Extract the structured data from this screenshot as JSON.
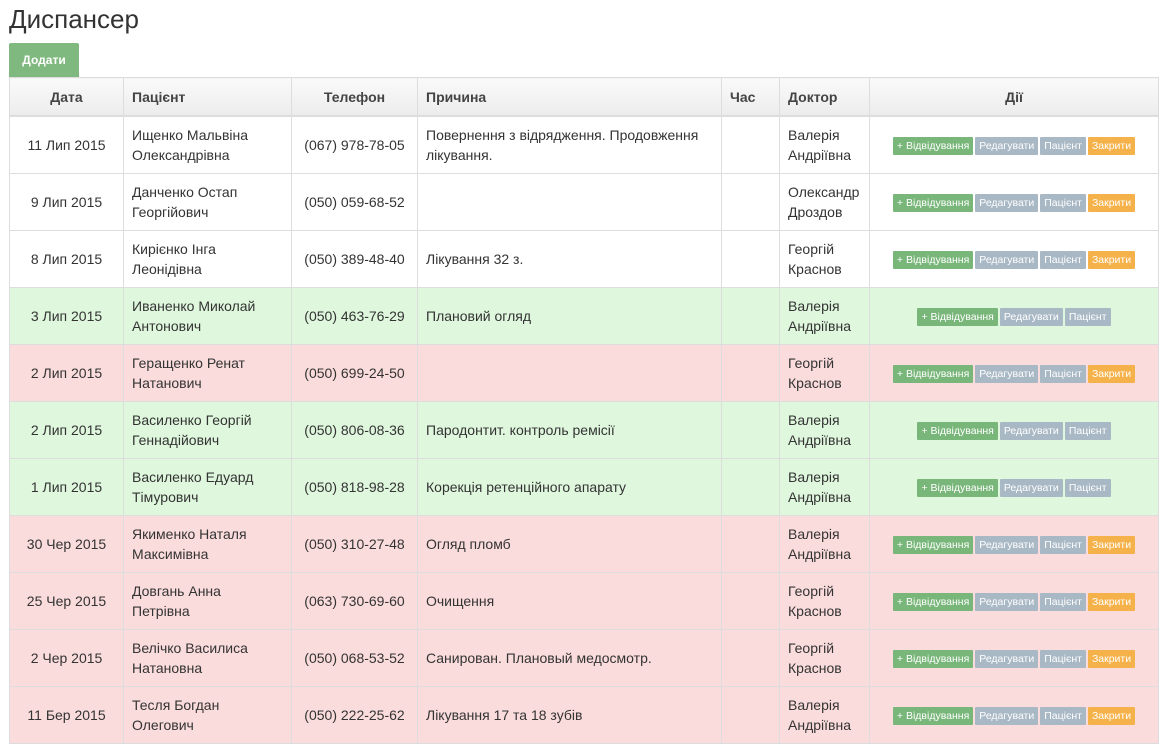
{
  "page": {
    "title": "Диспансер"
  },
  "toolbar": {
    "add_label": "Додати"
  },
  "table": {
    "columns": {
      "date": "Дата",
      "patient": "Пацієнт",
      "phone": "Телефон",
      "reason": "Причина",
      "time": "Час",
      "doctor": "Доктор",
      "actions": "Дії"
    },
    "action_labels": {
      "visit": "+ Відвідування",
      "edit": "Редагувати",
      "patient": "Пацієнт",
      "close": "Закрити"
    },
    "rows": [
      {
        "date": "11 Лип 2015",
        "patient_line1": "Ищенко Мальвіна",
        "patient_line2": "Олександрівна",
        "phone": "(067) 978-78-05",
        "reason": "Повернення з відрядження. Продовження лікування.",
        "time": "",
        "doctor_line1": "Валерія",
        "doctor_line2": "Андріївна",
        "status": "default",
        "closable": true
      },
      {
        "date": "9 Лип 2015",
        "patient_line1": "Данченко Остап",
        "patient_line2": "Георгійович",
        "phone": "(050) 059-68-52",
        "reason": "",
        "time": "",
        "doctor_line1": "Олександр",
        "doctor_line2": "Дроздов",
        "status": "default",
        "closable": true
      },
      {
        "date": "8 Лип 2015",
        "patient_line1": "Кирієнко Інга",
        "patient_line2": "Леонідівна",
        "phone": "(050) 389-48-40",
        "reason": "Лікування 32 з.",
        "time": "",
        "doctor_line1": "Георгій",
        "doctor_line2": "Краснов",
        "status": "default",
        "closable": true
      },
      {
        "date": "3 Лип 2015",
        "patient_line1": "Иваненко Миколай",
        "patient_line2": "Антонович",
        "phone": "(050) 463-76-29",
        "reason": "Плановий огляд",
        "time": "",
        "doctor_line1": "Валерія",
        "doctor_line2": "Андріївна",
        "status": "success",
        "closable": false
      },
      {
        "date": "2 Лип 2015",
        "patient_line1": "Геращенко Ренат",
        "patient_line2": "Натанович",
        "phone": "(050) 699-24-50",
        "reason": "",
        "time": "",
        "doctor_line1": "Георгій",
        "doctor_line2": "Краснов",
        "status": "danger",
        "closable": true
      },
      {
        "date": "2 Лип 2015",
        "patient_line1": "Василенко Георгій",
        "patient_line2": "Геннадійович",
        "phone": "(050) 806-08-36",
        "reason": "Пародонтит. контроль ремісії",
        "time": "",
        "doctor_line1": "Валерія",
        "doctor_line2": "Андріївна",
        "status": "success",
        "closable": false
      },
      {
        "date": "1 Лип 2015",
        "patient_line1": "Василенко Едуард",
        "patient_line2": "Тімурович",
        "phone": "(050) 818-98-28",
        "reason": "Корекція ретенційного апарату",
        "time": "",
        "doctor_line1": "Валерія",
        "doctor_line2": "Андріївна",
        "status": "success",
        "closable": false
      },
      {
        "date": "30 Чер 2015",
        "patient_line1": "Якименко Наталя",
        "patient_line2": "Максимівна",
        "phone": "(050) 310-27-48",
        "reason": "Огляд пломб",
        "time": "",
        "doctor_line1": "Валерія",
        "doctor_line2": "Андріївна",
        "status": "danger",
        "closable": true
      },
      {
        "date": "25 Чер 2015",
        "patient_line1": "Довгань Анна",
        "patient_line2": "Петрівна",
        "phone": "(063) 730-69-60",
        "reason": "Очищення",
        "time": "",
        "doctor_line1": "Георгій",
        "doctor_line2": "Краснов",
        "status": "danger",
        "closable": true
      },
      {
        "date": "2 Чер 2015",
        "patient_line1": "Велічко Василиса",
        "patient_line2": "Натановна",
        "phone": "(050) 068-53-52",
        "reason": "Санирован. Плановый медосмотр.",
        "time": "",
        "doctor_line1": "Георгій",
        "doctor_line2": "Краснов",
        "status": "danger",
        "closable": true
      },
      {
        "date": "11 Бер 2015",
        "patient_line1": "Тесля Богдан",
        "patient_line2": "Олегович",
        "phone": "(050) 222-25-62",
        "reason": "Лікування 17 та 18 зубів",
        "time": "",
        "doctor_line1": "Валерія",
        "doctor_line2": "Андріївна",
        "status": "danger",
        "closable": true
      }
    ]
  },
  "colors": {
    "success_row": "#dff7dd",
    "danger_row": "#fbdcdc",
    "visit_button": "#79b67a",
    "edit_button": "#a9b8c5",
    "close_button": "#f6b24a"
  }
}
